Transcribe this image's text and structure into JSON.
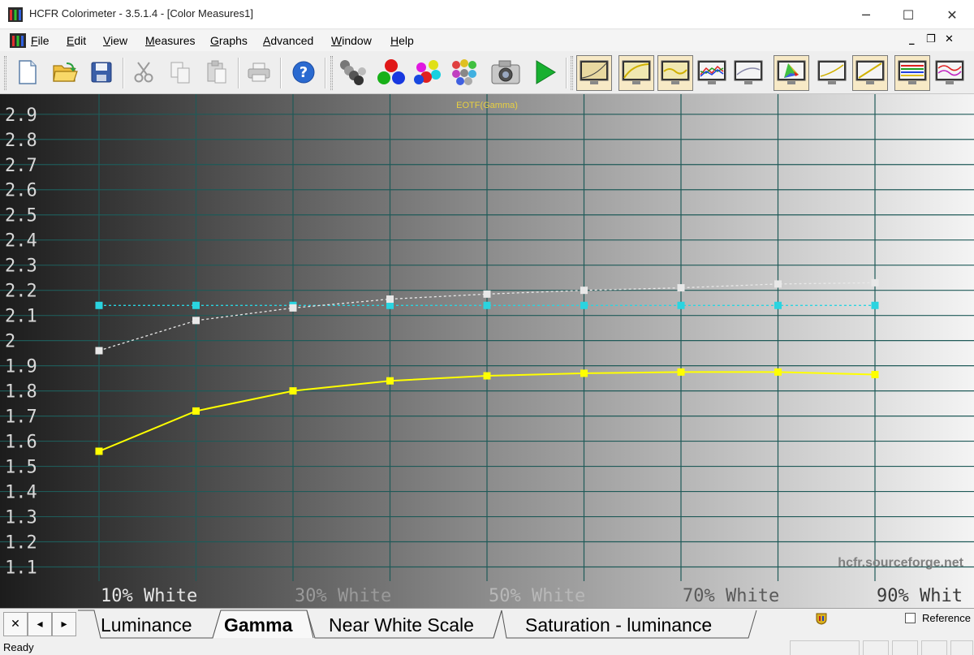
{
  "window": {
    "title": "HCFR Colorimeter - 3.5.1.4 - [Color Measures1]",
    "controls": {
      "minimize": "─",
      "maximize": "☐",
      "close": "✕"
    }
  },
  "menu": {
    "items": [
      "File",
      "Edit",
      "View",
      "Measures",
      "Graphs",
      "Advanced",
      "Window",
      "Help"
    ],
    "mdi_controls": {
      "minimize": "_",
      "restore": "❐",
      "close": "✕"
    }
  },
  "toolbar": {
    "icons": [
      "new-document-icon",
      "open-folder-icon",
      "save-icon",
      "cut-icon",
      "copy-icon",
      "paste-icon",
      "print-icon",
      "help-icon",
      "gray-measure-icon",
      "rgb-primaries-icon",
      "secondaries-icon",
      "saturation-icon",
      "camera-icon",
      "play-icon"
    ],
    "graph_icons": [
      "luminance-graph-icon",
      "gamma-graph-icon",
      "near-black-graph-icon",
      "rgb-levels-graph-icon",
      "color-temp-graph-icon",
      "cie-diagram-icon",
      "near-white-graph-icon",
      "saturation-luminance-graph-icon",
      "gamma-multi-graph-icon",
      "color-comparator-graph-icon"
    ]
  },
  "chart_data": {
    "type": "line",
    "title": "EOTF(Gamma)",
    "watermark": "hcfr.sourceforge.net",
    "x_labels": [
      "10% White",
      "30% White",
      "50% White",
      "70% White",
      "90% Whit"
    ],
    "x": [
      10,
      20,
      30,
      40,
      50,
      60,
      70,
      80,
      90
    ],
    "ylim": [
      1.05,
      2.98
    ],
    "y_ticks": [
      "2.9",
      "2.8",
      "2.7",
      "2.6",
      "2.5",
      "2.4",
      "2.3",
      "2.2",
      "2.1",
      "2",
      "1.9",
      "1.8",
      "1.7",
      "1.6",
      "1.5",
      "1.4",
      "1.3",
      "1.2",
      "1.1"
    ],
    "series": [
      {
        "values": [
          1.56,
          1.72,
          1.8,
          1.84,
          1.86,
          1.87,
          1.875,
          1.875,
          1.865
        ],
        "color": "#ffff00",
        "style": "solid"
      },
      {
        "values": [
          1.96,
          2.08,
          2.13,
          2.165,
          2.185,
          2.2,
          2.21,
          2.225,
          2.23
        ],
        "color": "#e8e8e8",
        "style": "dashed"
      },
      {
        "values": [
          2.14,
          2.14,
          2.14,
          2.14,
          2.14,
          2.14,
          2.14,
          2.14,
          2.14
        ],
        "color": "#2ad4e0",
        "style": "dashed"
      }
    ],
    "grid": true
  },
  "tabs": {
    "nav": {
      "close": "✕",
      "prev": "◂",
      "next": "▸"
    },
    "items": [
      "Luminance",
      "Gamma",
      "Near White Scale",
      "Saturation - luminance"
    ],
    "active": "Gamma",
    "reference_label": "Reference"
  },
  "status": {
    "text": "Ready"
  }
}
